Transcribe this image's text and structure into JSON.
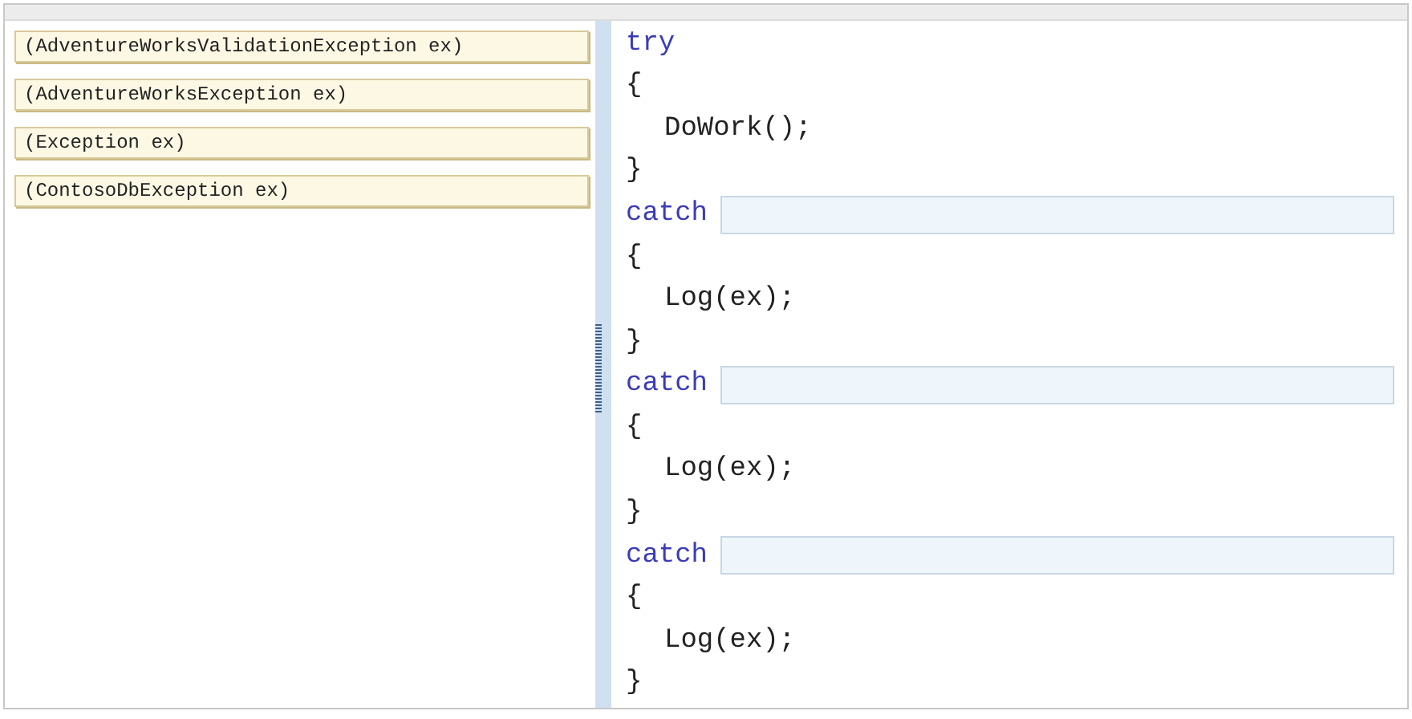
{
  "answer_choices": [
    {
      "text": "(AdventureWorksValidationException ex)"
    },
    {
      "text": "(AdventureWorksException ex)"
    },
    {
      "text": "(Exception ex)"
    },
    {
      "text": "(ContosoDbException ex)"
    }
  ],
  "code_lines": [
    {
      "kind": "keyword",
      "text": "try"
    },
    {
      "kind": "plain",
      "text": "{"
    },
    {
      "kind": "statement",
      "text": "DoWork();"
    },
    {
      "kind": "plain",
      "text": "}"
    },
    {
      "kind": "catch",
      "text": "catch"
    },
    {
      "kind": "plain",
      "text": "{"
    },
    {
      "kind": "statement",
      "text": "Log(ex);"
    },
    {
      "kind": "plain",
      "text": "}"
    },
    {
      "kind": "catch",
      "text": "catch"
    },
    {
      "kind": "plain",
      "text": "{"
    },
    {
      "kind": "statement",
      "text": "Log(ex);"
    },
    {
      "kind": "plain",
      "text": "}"
    },
    {
      "kind": "catch",
      "text": "catch"
    },
    {
      "kind": "plain",
      "text": "{"
    },
    {
      "kind": "statement",
      "text": "Log(ex);"
    },
    {
      "kind": "plain",
      "text": "}"
    }
  ]
}
